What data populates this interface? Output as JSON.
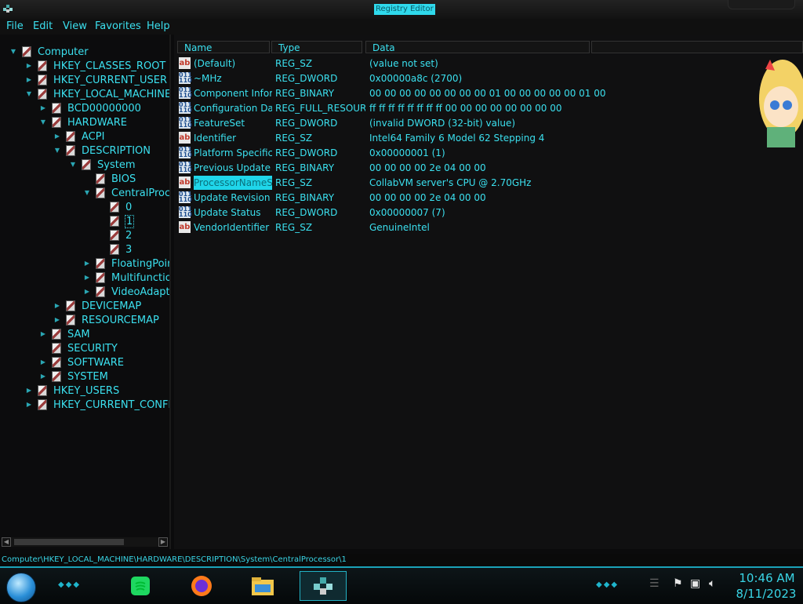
{
  "window": {
    "title": "Registry Editor",
    "app_icon": "registry-editor-icon"
  },
  "menu": [
    "File",
    "Edit",
    "View",
    "Favorites",
    "Help"
  ],
  "tree": [
    {
      "label": "Computer",
      "expander": "open"
    },
    {
      "label": "HKEY_CLASSES_ROOT",
      "expander": "closed"
    },
    {
      "label": "HKEY_CURRENT_USER",
      "expander": "closed"
    },
    {
      "label": "HKEY_LOCAL_MACHINE",
      "expander": "open"
    },
    {
      "label": "BCD00000000",
      "expander": "closed"
    },
    {
      "label": "HARDWARE",
      "expander": "open"
    },
    {
      "label": "ACPI",
      "expander": "closed"
    },
    {
      "label": "DESCRIPTION",
      "expander": "open"
    },
    {
      "label": "System",
      "expander": "open"
    },
    {
      "label": "BIOS",
      "expander": "none"
    },
    {
      "label": "CentralProce",
      "expander": "open"
    },
    {
      "label": "0",
      "expander": "none"
    },
    {
      "label": "1",
      "expander": "none",
      "selected": true
    },
    {
      "label": "2",
      "expander": "none"
    },
    {
      "label": "3",
      "expander": "none"
    },
    {
      "label": "FloatingPoint",
      "expander": "closed"
    },
    {
      "label": "Multifunction.",
      "expander": "closed"
    },
    {
      "label": "VideoAdapte",
      "expander": "closed"
    },
    {
      "label": "DEVICEMAP",
      "expander": "closed"
    },
    {
      "label": "RESOURCEMAP",
      "expander": "closed"
    },
    {
      "label": "SAM",
      "expander": "closed"
    },
    {
      "label": "SECURITY",
      "expander": "none"
    },
    {
      "label": "SOFTWARE",
      "expander": "closed"
    },
    {
      "label": "SYSTEM",
      "expander": "closed"
    },
    {
      "label": "HKEY_USERS",
      "expander": "closed"
    },
    {
      "label": "HKEY_CURRENT_CONFI",
      "expander": "closed"
    }
  ],
  "columns": {
    "name": "Name",
    "type": "Type",
    "data": "Data"
  },
  "values": [
    {
      "icon": "string-value-icon",
      "name": "(Default)",
      "type": "REG_SZ",
      "data": "(value not set)"
    },
    {
      "icon": "binary-value-icon",
      "name": "~MHz",
      "type": "REG_DWORD",
      "data": "0x00000a8c (2700)"
    },
    {
      "icon": "binary-value-icon",
      "name": "Component Infor...",
      "type": "REG_BINARY",
      "data": "00 00 00 00 00 00 00 00 01 00 00 00 00 00 01 00"
    },
    {
      "icon": "binary-value-icon",
      "name": "Configuration Data",
      "type": "REG_FULL_RESOUR...",
      "data": "ff ff ff ff ff ff ff ff 00 00 00 00 00 00 00 00"
    },
    {
      "icon": "binary-value-icon",
      "name": "FeatureSet",
      "type": "REG_DWORD",
      "data": "(invalid DWORD (32-bit) value)"
    },
    {
      "icon": "string-value-icon",
      "name": "Identifier",
      "type": "REG_SZ",
      "data": "Intel64 Family 6 Model 62 Stepping 4"
    },
    {
      "icon": "binary-value-icon",
      "name": "Platform Specific ...",
      "type": "REG_DWORD",
      "data": "0x00000001 (1)"
    },
    {
      "icon": "binary-value-icon",
      "name": "Previous Update ...",
      "type": "REG_BINARY",
      "data": "00 00 00 00 2e 04 00 00"
    },
    {
      "icon": "string-value-icon",
      "name": "ProcessorNameS",
      "type": "REG_SZ",
      "data": "CollabVM server's CPU @ 2.70GHz",
      "selected": true
    },
    {
      "icon": "binary-value-icon",
      "name": "Update Revision",
      "type": "REG_BINARY",
      "data": "00 00 00 00 2e 04 00 00"
    },
    {
      "icon": "binary-value-icon",
      "name": "Update Status",
      "type": "REG_DWORD",
      "data": "0x00000007 (7)"
    },
    {
      "icon": "string-value-icon",
      "name": "VendorIdentifier",
      "type": "REG_SZ",
      "data": "GenuineIntel"
    }
  ],
  "status": {
    "path": "Computer\\HKEY_LOCAL_MACHINE\\HARDWARE\\DESCRIPTION\\System\\CentralProcessor\\1"
  },
  "taskbar": {
    "apps": [
      {
        "icon": "spotify-icon"
      },
      {
        "icon": "firefox-icon"
      },
      {
        "icon": "file-explorer-icon"
      },
      {
        "icon": "registry-editor-icon",
        "active": true
      }
    ],
    "tray": [
      "flag-icon",
      "network-icon",
      "volume-icon"
    ],
    "time": "10:46 AM",
    "date": "8/11/2023"
  },
  "colors": {
    "accent": "#3be0ef",
    "selection": "#1fd6ea",
    "background": "#0c0c0d"
  }
}
